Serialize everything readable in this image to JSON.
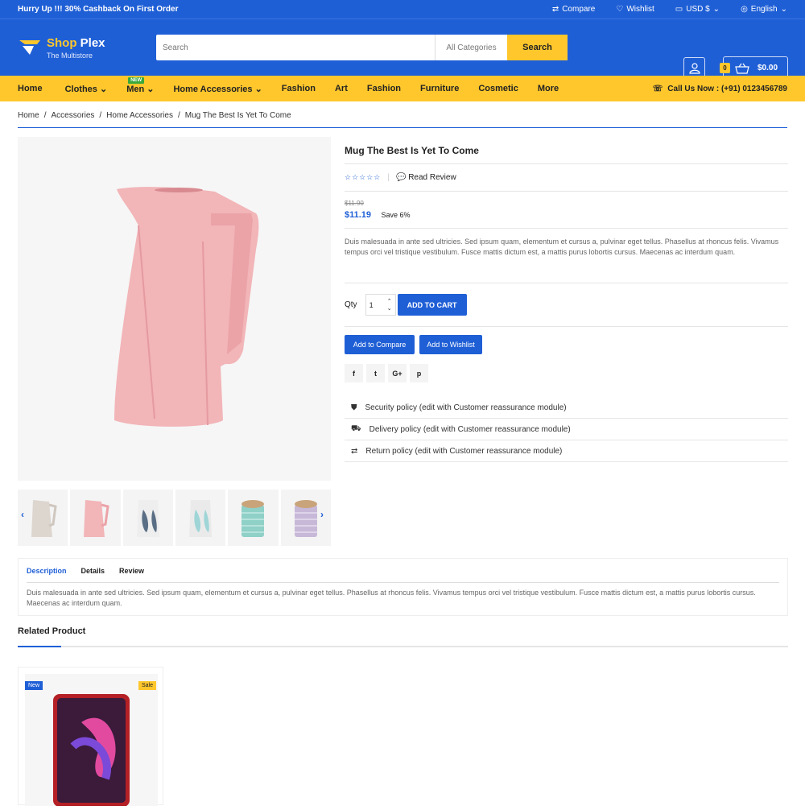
{
  "topbar": {
    "promo": "Hurry Up !!! 30% Cashback On First Order",
    "compare": "Compare",
    "wishlist": "Wishlist",
    "currency": "USD $",
    "language": "English"
  },
  "header": {
    "logo_primary": "Shop",
    "logo_secondary": "Plex",
    "tagline": "The Multistore",
    "search_placeholder": "Search",
    "category": "All Categories",
    "search_button": "Search",
    "cart_count": "0",
    "cart_total": "$0.00"
  },
  "nav": {
    "items": [
      "Home",
      "Clothes",
      "Men",
      "Home Accessories",
      "Fashion",
      "Art",
      "Fashion",
      "Furniture",
      "Cosmetic",
      "More"
    ],
    "new_badge": "NEW",
    "call": "Call Us Now : (+91) 0123456789"
  },
  "breadcrumb": [
    "Home",
    "Accessories",
    "Home Accessories",
    "Mug The Best Is Yet To Come"
  ],
  "product": {
    "title": "Mug The Best Is Yet To Come",
    "rating": 0,
    "read_review": "Read Review",
    "old_price": "$11.90",
    "price": "$11.19",
    "save": "Save 6%",
    "description": "Duis malesuada in ante sed ultricies. Sed ipsum quam, elementum et cursus a, pulvinar eget tellus. Phasellus at rhoncus felis. Vivamus tempus orci vel tristique vestibulum. Fusce mattis dictum est, a mattis purus lobortis cursus. Maecenas ac interdum quam.",
    "qty_label": "Qty",
    "qty": "1",
    "add_to_cart": "ADD TO CART",
    "add_to_compare": "Add to Compare",
    "add_to_wishlist": "Add to Wishlist",
    "share": [
      "f",
      "t",
      "G+",
      "p"
    ],
    "policies": [
      {
        "icon": "shield-icon",
        "text": "Security policy (edit with Customer reassurance module)"
      },
      {
        "icon": "truck-icon",
        "text": "Delivery policy (edit with Customer reassurance module)"
      },
      {
        "icon": "swap-icon",
        "text": "Return policy (edit with Customer reassurance module)"
      }
    ],
    "colors": {
      "accent": "#1f5fd6",
      "yellow": "#ffc72c",
      "pitcher": "#f2b5b8"
    }
  },
  "tabs": {
    "items": [
      "Description",
      "Details",
      "Review"
    ],
    "active": "Description",
    "text": "Duis malesuada in ante sed ultricies. Sed ipsum quam, elementum et cursus a, pulvinar eget tellus. Phasellus at rhoncus felis. Vivamus tempus orci vel tristique vestibulum. Fusce mattis dictum est, a mattis purus lobortis cursus. Maecenas ac interdum quam."
  },
  "related": {
    "title": "Related Product",
    "card": {
      "new_badge": "New",
      "sale_badge": "Sale"
    }
  }
}
